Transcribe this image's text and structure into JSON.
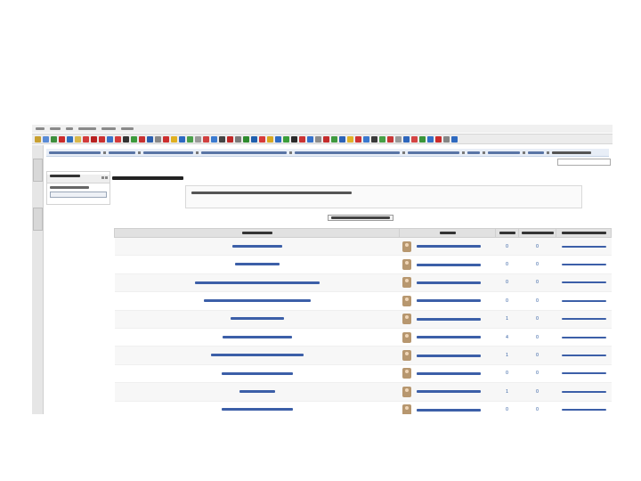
{
  "menubar": {
    "items": [
      {
        "label": ""
      },
      {
        "label": ""
      },
      {
        "label": ""
      },
      {
        "label": ""
      },
      {
        "label": ""
      },
      {
        "label": ""
      }
    ]
  },
  "toolbar": {
    "icons": [
      {
        "name": "back-icon",
        "color": "#c8a030"
      },
      {
        "name": "forward-icon",
        "color": "#5a8bd6"
      },
      {
        "name": "reload-icon",
        "color": "#3d8f3d"
      },
      {
        "name": "stop-icon",
        "color": "#cc2a2a"
      },
      {
        "name": "home-icon",
        "color": "#2f6fc0"
      },
      {
        "name": "bookmark-icon",
        "color": "#d9b84a"
      },
      {
        "name": "addon-red-icon",
        "color": "#d23b3b"
      },
      {
        "name": "addon-red-icon",
        "color": "#b82020"
      },
      {
        "name": "addon-red-icon",
        "color": "#cc3030"
      },
      {
        "name": "addon-blue-icon",
        "color": "#3a73c8"
      },
      {
        "name": "addon-red-icon",
        "color": "#d43a3a"
      },
      {
        "name": "addon-dark-icon",
        "color": "#333333"
      },
      {
        "name": "addon-green-icon",
        "color": "#3b9a3b"
      },
      {
        "name": "addon-red-icon",
        "color": "#c83030"
      },
      {
        "name": "addon-blue-icon",
        "color": "#2a5fb0"
      },
      {
        "name": "addon-grey-icon",
        "color": "#888888"
      },
      {
        "name": "addon-red-icon",
        "color": "#cc2f2f"
      },
      {
        "name": "addon-yellow-icon",
        "color": "#e0b020"
      },
      {
        "name": "addon-blue-icon",
        "color": "#2c69c2"
      },
      {
        "name": "addon-green-icon",
        "color": "#4aa04a"
      },
      {
        "name": "addon-grey-icon",
        "color": "#9a9a9a"
      },
      {
        "name": "addon-red-icon",
        "color": "#d04040"
      },
      {
        "name": "addon-blue-icon",
        "color": "#3a7ad0"
      },
      {
        "name": "addon-dark-icon",
        "color": "#444444"
      },
      {
        "name": "addon-red-icon",
        "color": "#c02828"
      },
      {
        "name": "addon-grey-icon",
        "color": "#7a7a7a"
      },
      {
        "name": "addon-green-icon",
        "color": "#2e8b2e"
      },
      {
        "name": "addon-blue-icon",
        "color": "#1f5fae"
      },
      {
        "name": "addon-red-icon",
        "color": "#d83a3a"
      },
      {
        "name": "addon-yellow-icon",
        "color": "#d8a820"
      },
      {
        "name": "addon-blue-icon",
        "color": "#2f6cc4"
      },
      {
        "name": "addon-green-icon",
        "color": "#3a9e3a"
      },
      {
        "name": "addon-dark-icon",
        "color": "#2a2a2a"
      },
      {
        "name": "addon-red-icon",
        "color": "#cc3333"
      },
      {
        "name": "addon-blue-icon",
        "color": "#3572cc"
      },
      {
        "name": "addon-grey-icon",
        "color": "#8c8c8c"
      },
      {
        "name": "addon-red-icon",
        "color": "#c42c2c"
      },
      {
        "name": "addon-green-icon",
        "color": "#3f9a3f"
      },
      {
        "name": "addon-blue-icon",
        "color": "#2b63b8"
      },
      {
        "name": "addon-yellow-icon",
        "color": "#e0b228"
      },
      {
        "name": "addon-red-icon",
        "color": "#d03434"
      },
      {
        "name": "addon-blue-icon",
        "color": "#3a78cf"
      },
      {
        "name": "addon-dark-icon",
        "color": "#3a3a3a"
      },
      {
        "name": "addon-green-icon",
        "color": "#46a046"
      },
      {
        "name": "addon-red-icon",
        "color": "#c83636"
      },
      {
        "name": "addon-grey-icon",
        "color": "#999999"
      },
      {
        "name": "addon-blue-icon",
        "color": "#2d66bc"
      },
      {
        "name": "addon-red-icon",
        "color": "#d44444"
      },
      {
        "name": "addon-green-icon",
        "color": "#3a963a"
      },
      {
        "name": "addon-blue-icon",
        "color": "#3270c8"
      },
      {
        "name": "addon-red-icon",
        "color": "#cc2c2c"
      },
      {
        "name": "addon-grey-icon",
        "color": "#858585"
      },
      {
        "name": "addon-blue-icon",
        "color": "#2f6ac0"
      }
    ]
  },
  "left_tabs": [
    {
      "label": ""
    },
    {
      "label": ""
    }
  ],
  "breadcrumbs": [
    {
      "label": ""
    },
    {
      "label": ""
    },
    {
      "label": ""
    },
    {
      "label": ""
    },
    {
      "label": ""
    },
    {
      "label": ""
    },
    {
      "label": ""
    },
    {
      "label": ""
    },
    {
      "label": ""
    },
    {
      "label": ""
    }
  ],
  "search": {
    "placeholder": ""
  },
  "side_block": {
    "title": "",
    "line1": "",
    "select_value": ""
  },
  "forum": {
    "title": "",
    "intro": "",
    "new_topic_button": ""
  },
  "table": {
    "headers": {
      "topic": "",
      "started_by": "",
      "replies": "",
      "unread": "",
      "last_post": ""
    },
    "rows": [
      {
        "topic": "",
        "author": "",
        "replies": "0",
        "unread": "0",
        "last_post": ""
      },
      {
        "topic": "",
        "author": "",
        "replies": "0",
        "unread": "0",
        "last_post": ""
      },
      {
        "topic": "",
        "author": "",
        "replies": "0",
        "unread": "0",
        "last_post": ""
      },
      {
        "topic": "",
        "author": "",
        "replies": "0",
        "unread": "0",
        "last_post": ""
      },
      {
        "topic": "",
        "author": "",
        "replies": "1",
        "unread": "0",
        "last_post": ""
      },
      {
        "topic": "",
        "author": "",
        "replies": "4",
        "unread": "0",
        "last_post": ""
      },
      {
        "topic": "",
        "author": "",
        "replies": "1",
        "unread": "0",
        "last_post": ""
      },
      {
        "topic": "",
        "author": "",
        "replies": "0",
        "unread": "0",
        "last_post": ""
      },
      {
        "topic": "",
        "author": "",
        "replies": "1",
        "unread": "0",
        "last_post": ""
      },
      {
        "topic": "",
        "author": "",
        "replies": "0",
        "unread": "0",
        "last_post": ""
      }
    ]
  }
}
